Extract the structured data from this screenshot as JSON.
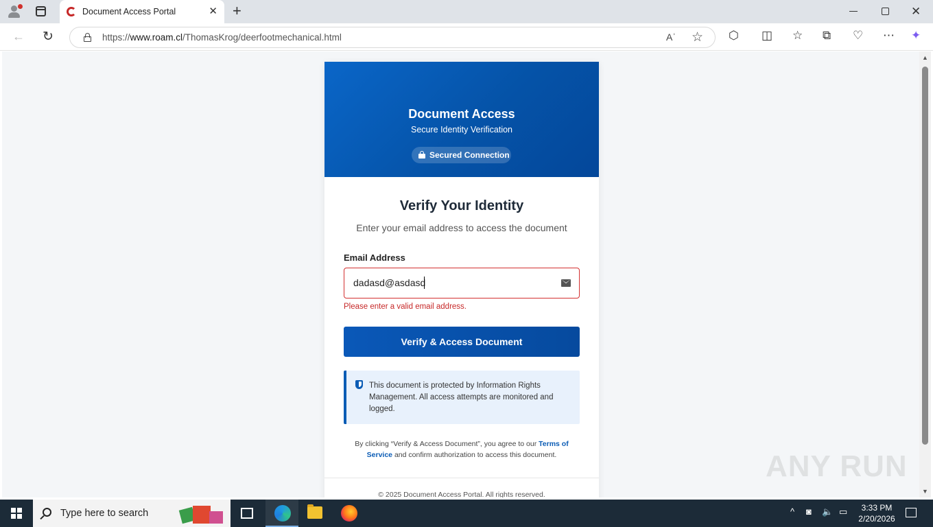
{
  "browser": {
    "tab_title": "Document Access Portal",
    "url_prefix": "https://",
    "url_domain": "www.roam.cl",
    "url_path": "/ThomasKrog/deerfootmechanical.html",
    "read_aloud_label": "Aʾ"
  },
  "header": {
    "title": "Document Access",
    "subtitle": "Secure Identity Verification",
    "badge": "Secured Connection"
  },
  "form": {
    "title": "Verify Your Identity",
    "subtitle": "Enter your email address to access the document",
    "email_label": "Email Address",
    "email_value": "dadasd@asdasd",
    "error": "Please enter a valid email address.",
    "submit_label": "Verify & Access Document"
  },
  "notice": {
    "text": "This document is protected by Information Rights Management. All access attempts are monitored and logged."
  },
  "legal": {
    "prefix": "By clicking “Verify & Access Document”, you agree to our ",
    "link": "Terms of Service",
    "suffix": " and confirm authorization to access this document."
  },
  "footer": {
    "text": "© 2025 Document Access Portal. All rights reserved."
  },
  "watermark": "ANY RUN",
  "taskbar": {
    "search_placeholder": "Type here to search",
    "time": "3:33 PM",
    "date": "2/20/2026"
  },
  "colors": {
    "header_blue": "#0553a8",
    "error_red": "#c62828",
    "button_blue": "#0a58b8"
  }
}
